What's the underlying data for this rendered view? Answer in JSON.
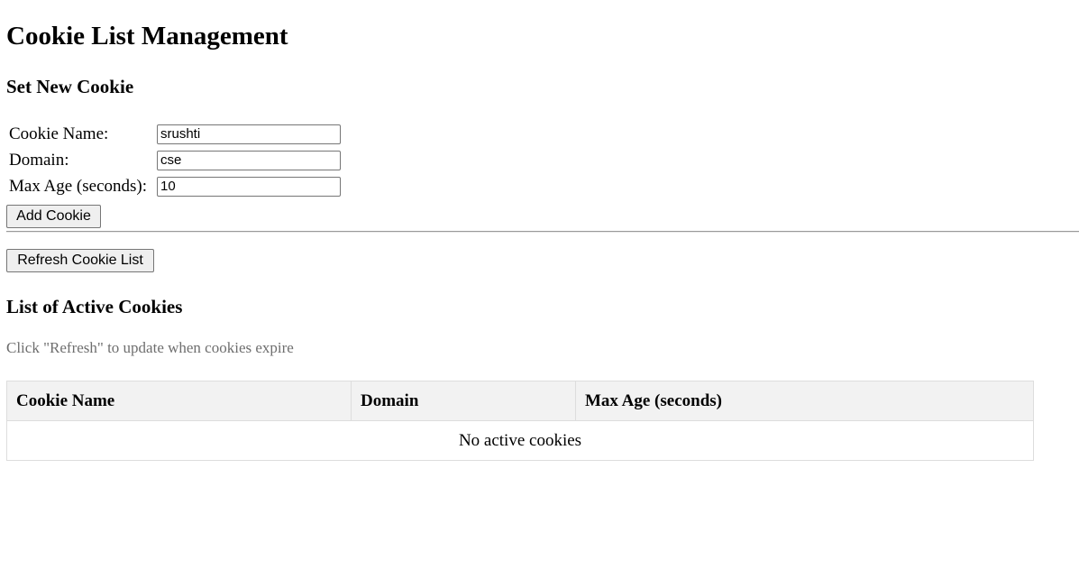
{
  "page": {
    "title": "Cookie List Management"
  },
  "set_cookie": {
    "heading": "Set New Cookie",
    "fields": [
      {
        "label": "Cookie Name:",
        "value": "srushti"
      },
      {
        "label": "Domain:",
        "value": "cse"
      },
      {
        "label": "Max Age (seconds):",
        "value": "10"
      }
    ],
    "add_button_label": "Add Cookie"
  },
  "refresh_button_label": "Refresh Cookie List",
  "active_cookies": {
    "heading": "List of Active Cookies",
    "hint": "Click \"Refresh\" to update when cookies expire",
    "columns": [
      "Cookie Name",
      "Domain",
      "Max Age (seconds)"
    ],
    "empty_message": "No active cookies"
  },
  "colors": {
    "header_bg": "#f2f2f2",
    "hint_text": "#6e6e6e",
    "border": "#dddddd"
  }
}
